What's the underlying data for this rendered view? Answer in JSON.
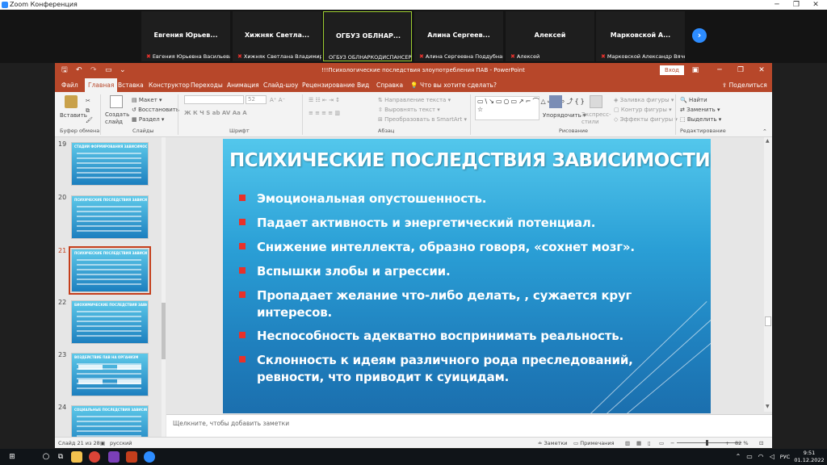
{
  "zoom": {
    "window_title": "Zoom Конференция",
    "participants": [
      {
        "display": "Евгения Юрьев...",
        "full": "Евгения Юрьевна Васильева",
        "muted": true
      },
      {
        "display": "Хижняк Светла...",
        "full": "Хижняк Светлана Владимиро...",
        "muted": true
      },
      {
        "display": "ОГБУЗ ОБЛНАР...",
        "full": "ОГБУЗ ОБЛНАРКОДИСПАНСЕР",
        "muted": false
      },
      {
        "display": "Алина Сергеев...",
        "full": "Алина Сергеевна Поддубная",
        "muted": true
      },
      {
        "display": "Алексей",
        "full": "Алексей",
        "muted": true
      },
      {
        "display": "Марковской А...",
        "full": "Марковской Александр Вяче...",
        "muted": true
      }
    ],
    "colors": {
      "active_border": "#9ccc30",
      "mute": "#e5322d",
      "next_button": "#2d8cff"
    }
  },
  "ppt": {
    "doc_title": "!!!Психологические последствия злоупотребления ПАВ",
    "app_name": "PowerPoint",
    "login_label": "Вход",
    "share_label": "Поделиться",
    "accent_color": "#b7472a",
    "tabs": [
      "Файл",
      "Главная",
      "Вставка",
      "Конструктор",
      "Переходы",
      "Анимация",
      "Слайд-шоу",
      "Рецензирование",
      "Вид",
      "Справка"
    ],
    "tell_me": "Что вы хотите сделать?",
    "ribbon": {
      "paste": "Вставить",
      "new_slide": "Создать слайд",
      "layout": "Макет",
      "reset": "Восстановить",
      "section": "Раздел",
      "font_size": "52",
      "text_direction": "Направление текста",
      "align_text": "Выровнять текст",
      "smartart": "Преобразовать в SmartArt",
      "arrange": "Упорядочить",
      "quick_styles": "Экспресс-стили",
      "shape_fill": "Заливка фигуры",
      "shape_outline": "Контур фигуры",
      "shape_effects": "Эффекты фигуры",
      "find": "Найти",
      "replace": "Заменить",
      "select": "Выделить",
      "groups": {
        "clipboard": "Буфер обмена",
        "slides": "Слайды",
        "font": "Шрифт",
        "paragraph": "Абзац",
        "drawing": "Рисование",
        "editing": "Редактирование"
      }
    },
    "thumbnails": [
      {
        "num": "19",
        "title": "СТАДИИ ФОРМИРОВАНИЯ ЗАВИСИМОСТИ"
      },
      {
        "num": "20",
        "title": "ПСИХИЧЕСКИЕ ПОСЛЕДСТВИЯ ЗАВИСИМОСТИ"
      },
      {
        "num": "21",
        "title": "ПСИХИЧЕСКИЕ ПОСЛЕДСТВИЯ ЗАВИСИМОСТИ",
        "selected": true
      },
      {
        "num": "22",
        "title": "БИОХИМИЧЕСКИЕ ПОСЛЕДСТВИЯ ЗАВИСИМОСТИ"
      },
      {
        "num": "23",
        "title": "ВОЗДЕЙСТВИЕ ПАВ НА ОРГАНИЗМ"
      },
      {
        "num": "24",
        "title": "СОЦИАЛЬНЫЕ ПОСЛЕДСТВИЯ ЗАВИСИМОСТИ"
      }
    ],
    "slide": {
      "title": "ПСИХИЧЕСКИЕ ПОСЛЕДСТВИЯ ЗАВИСИМОСТИ",
      "bullets": [
        {
          "line1": "Эмоциональная опустошенность."
        },
        {
          "line1": "Падает активность и энергетический потенциал."
        },
        {
          "line1": "Снижение интеллекта, образно говоря, «сохнет мозг»."
        },
        {
          "line1": "Вспышки злобы и агрессии."
        },
        {
          "line1": "Пропадает желание что-либо делать, , сужается круг",
          "line2": "интересов."
        },
        {
          "line1": "Неспособность адекватно воспринимать реальность."
        },
        {
          "line1": "Склонность к идеям различного рода преследований,",
          "line2": "ревности, что приводит к суицидам."
        }
      ],
      "bullet_color": "#e8312a"
    },
    "notes_placeholder": "Щелкните, чтобы добавить заметки",
    "status": {
      "slide_counter": "Слайд 21 из 28",
      "language": "русский",
      "notes": "Заметки",
      "comments": "Примечания",
      "zoom": "82 %"
    }
  },
  "taskbar": {
    "language": "РУС",
    "time": "9:51",
    "date": "01.12.2022"
  }
}
